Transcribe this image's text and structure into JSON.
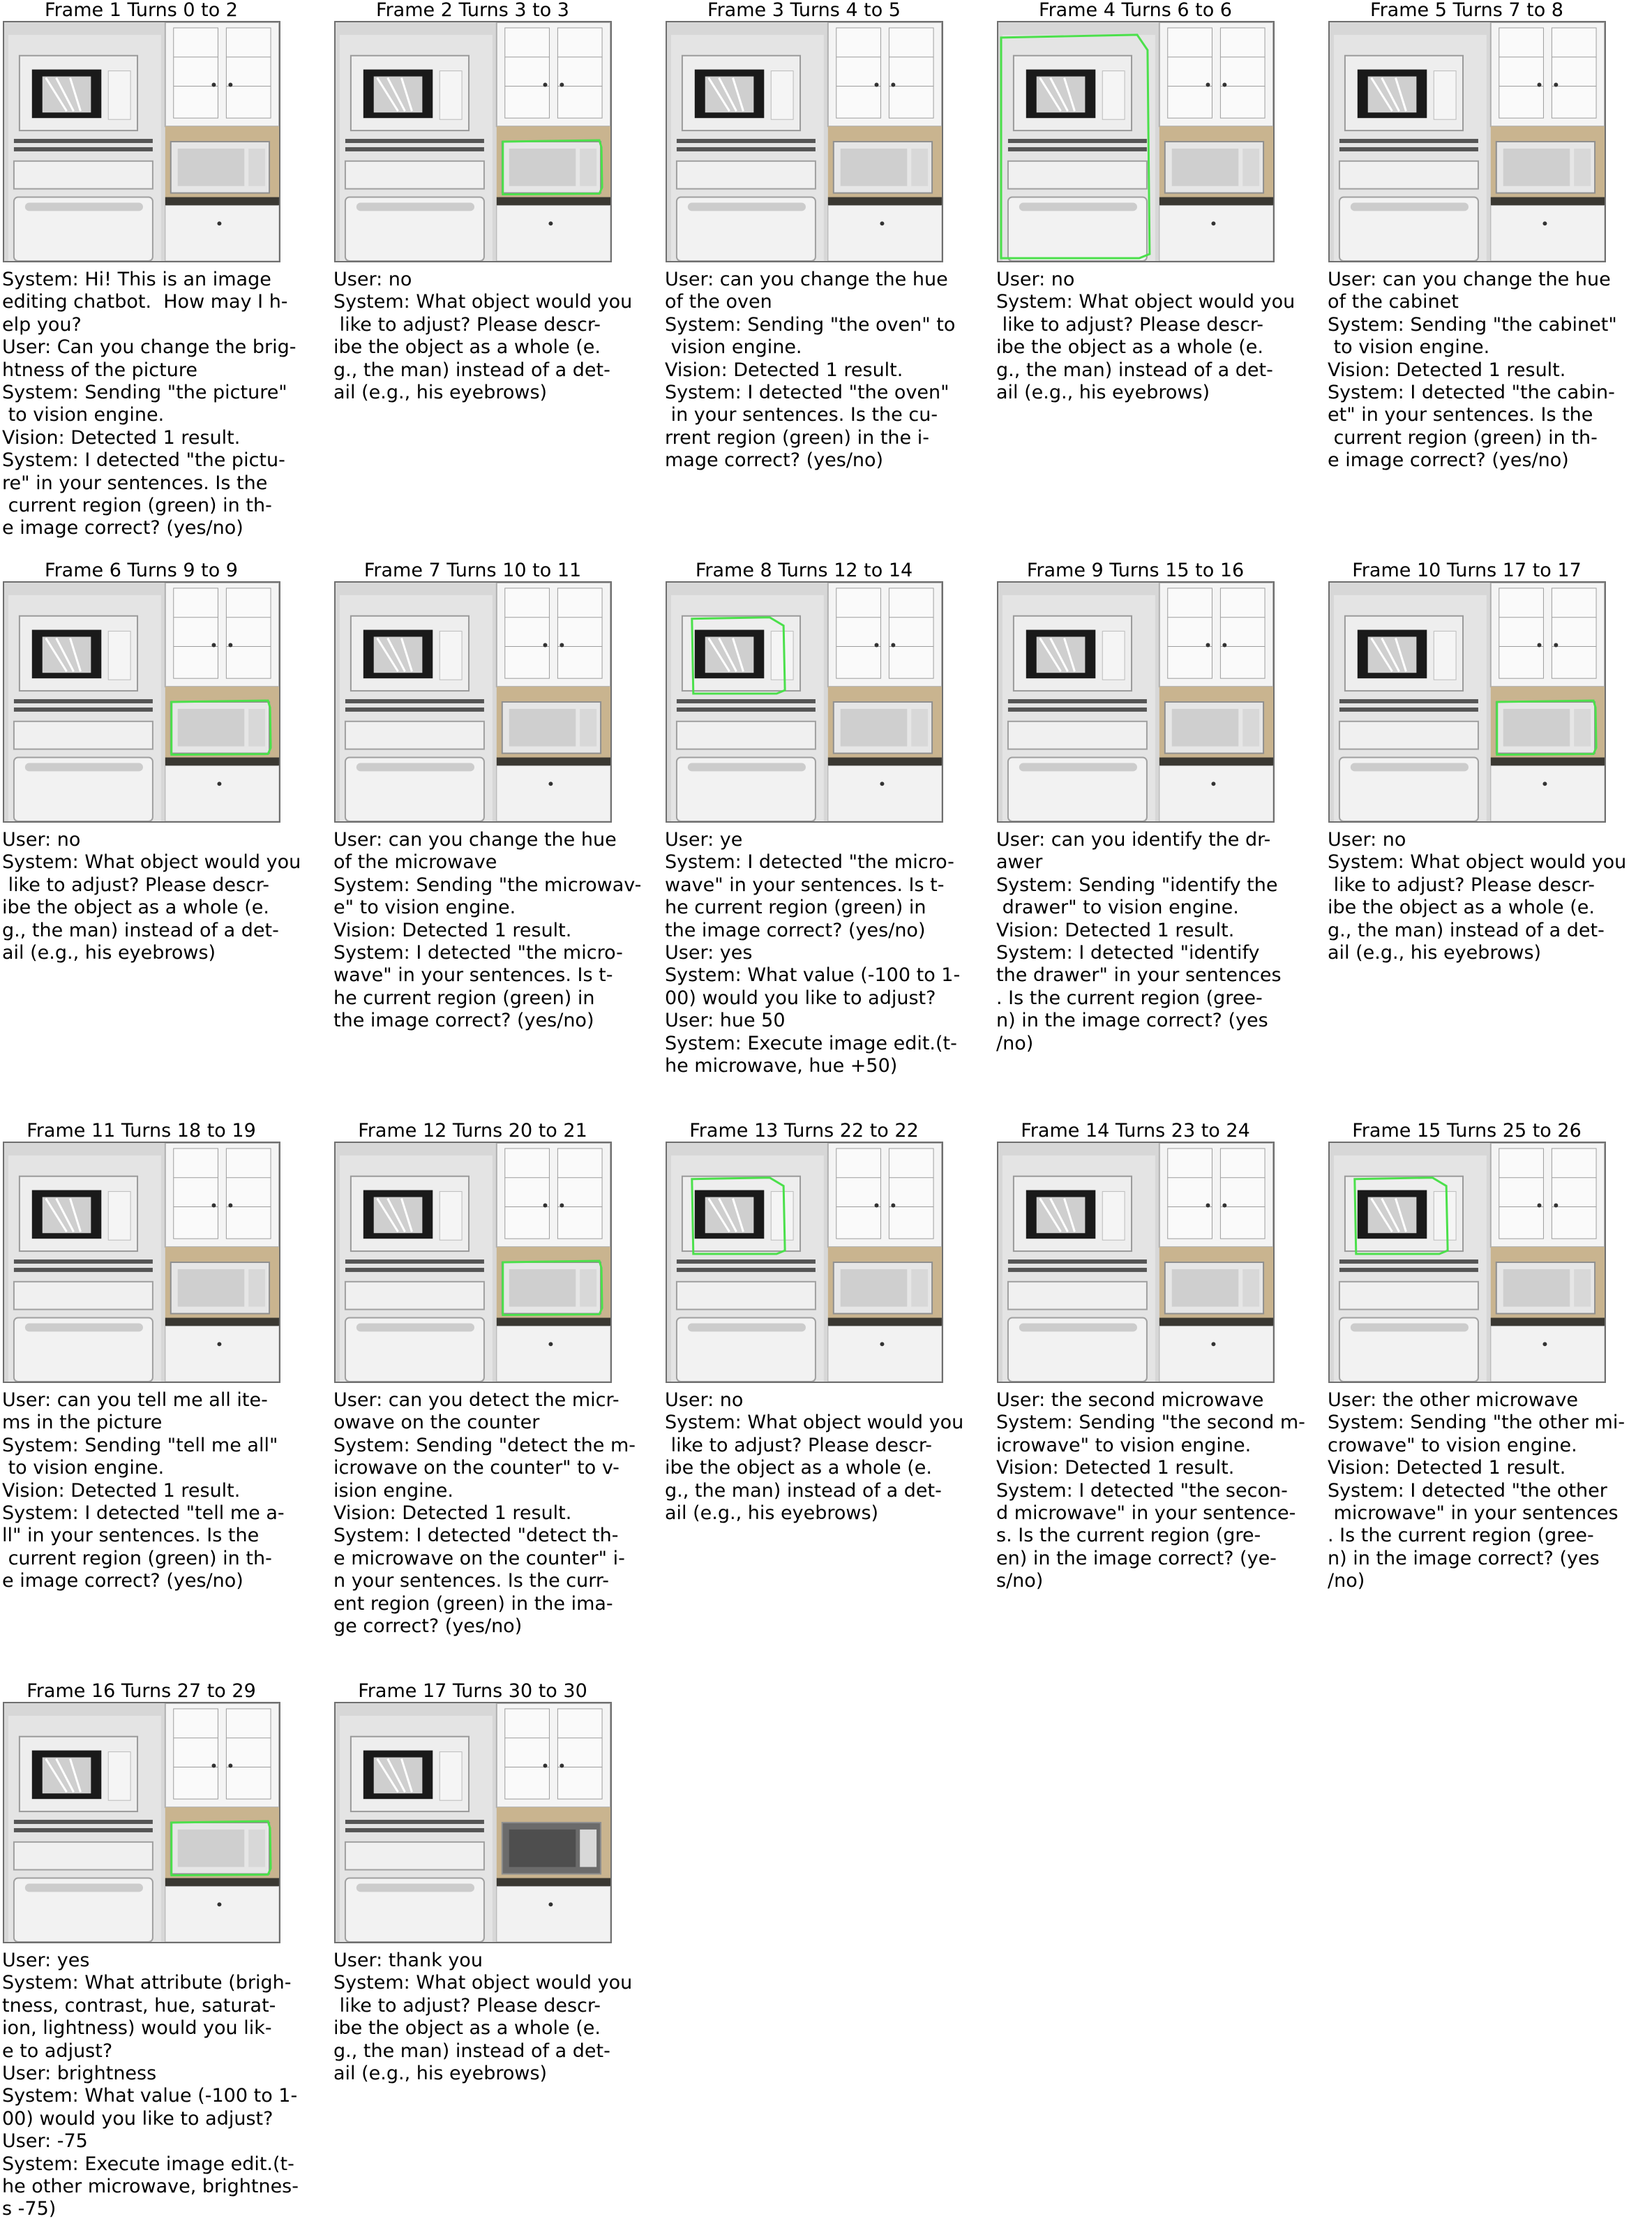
{
  "frames": [
    {
      "title": "Frame 1 Turns 0 to 2",
      "highlight": "",
      "edited": false,
      "text": "System: Hi! This is an image\nediting chatbot.  How may I h-\nelp you?\nUser: Can you change the brig-\nhtness of the picture\nSystem: Sending \"the picture\"\n to vision engine.\nVision: Detected 1 result.\nSystem: I detected \"the pictu-\nre\" in your sentences. Is the\n current region (green) in th-\ne image correct? (yes/no)"
    },
    {
      "title": "Frame 2 Turns 3 to 3",
      "highlight": "counter-microwave",
      "edited": false,
      "text": "User: no\nSystem: What object would you\n like to adjust? Please descr-\nibe the object as a whole (e.\ng., the man) instead of a det-\nail (e.g., his eyebrows)"
    },
    {
      "title": "Frame 3 Turns 4 to 5",
      "highlight": "",
      "edited": false,
      "text": "User: can you change the hue\nof the oven\nSystem: Sending \"the oven\" to\n vision engine.\nVision: Detected 1 result.\nSystem: I detected \"the oven\"\n in your sentences. Is the cu-\nrrent region (green) in the i-\nmage correct? (yes/no)"
    },
    {
      "title": "Frame 4 Turns 6 to 6",
      "highlight": "oven",
      "edited": false,
      "text": "User: no\nSystem: What object would you\n like to adjust? Please descr-\nibe the object as a whole (e.\ng., the man) instead of a det-\nail (e.g., his eyebrows)"
    },
    {
      "title": "Frame 5 Turns 7 to 8",
      "highlight": "",
      "edited": false,
      "text": "User: can you change the hue\nof the cabinet\nSystem: Sending \"the cabinet\"\n to vision engine.\nVision: Detected 1 result.\nSystem: I detected \"the cabin-\net\" in your sentences. Is the\n current region (green) in th-\ne image correct? (yes/no)"
    },
    {
      "title": "Frame 6 Turns 9 to 9",
      "highlight": "counter-microwave",
      "edited": false,
      "text": "User: no\nSystem: What object would you\n like to adjust? Please descr-\nibe the object as a whole (e.\ng., the man) instead of a det-\nail (e.g., his eyebrows)"
    },
    {
      "title": "Frame 7 Turns 10 to 11",
      "highlight": "",
      "edited": false,
      "text": "User: can you change the hue\nof the microwave\nSystem: Sending \"the microwav-\ne\" to vision engine.\nVision: Detected 1 result.\nSystem: I detected \"the micro-\nwave\" in your sentences. Is t-\nhe current region (green) in\nthe image correct? (yes/no)"
    },
    {
      "title": "Frame 8 Turns 12 to 14",
      "highlight": "wall-microwave",
      "edited": false,
      "text": "User: ye\nSystem: I detected \"the micro-\nwave\" in your sentences. Is t-\nhe current region (green) in\nthe image correct? (yes/no)\nUser: yes\nSystem: What value (-100 to 1-\n00) would you like to adjust?\nUser: hue 50\nSystem: Execute image edit.(t-\nhe microwave, hue +50)"
    },
    {
      "title": "Frame 9 Turns 15 to 16",
      "highlight": "",
      "edited": false,
      "text": "User: can you identify the dr-\nawer\nSystem: Sending \"identify the\n drawer\" to vision engine.\nVision: Detected 1 result.\nSystem: I detected \"identify\nthe drawer\" in your sentences\n. Is the current region (gree-\nn) in the image correct? (yes\n/no)"
    },
    {
      "title": "Frame 10 Turns 17 to 17",
      "highlight": "counter-microwave",
      "edited": false,
      "text": "User: no\nSystem: What object would you\n like to adjust? Please descr-\nibe the object as a whole (e.\ng., the man) instead of a det-\nail (e.g., his eyebrows)"
    },
    {
      "title": "Frame 11 Turns 18 to 19",
      "highlight": "",
      "edited": false,
      "text": "User: can you tell me all ite-\nms in the picture\nSystem: Sending \"tell me all\"\n to vision engine.\nVision: Detected 1 result.\nSystem: I detected \"tell me a-\nll\" in your sentences. Is the\n current region (green) in th-\ne image correct? (yes/no)"
    },
    {
      "title": "Frame 12 Turns 20 to 21",
      "highlight": "counter-microwave",
      "edited": false,
      "text": "User: can you detect the micr-\nowave on the counter\nSystem: Sending \"detect the m-\nicrowave on the counter\" to v-\nision engine.\nVision: Detected 1 result.\nSystem: I detected \"detect th-\ne microwave on the counter\" i-\nn your sentences. Is the curr-\nent region (green) in the ima-\nge correct? (yes/no)"
    },
    {
      "title": "Frame 13 Turns 22 to 22",
      "highlight": "wall-microwave",
      "edited": false,
      "text": "User: no\nSystem: What object would you\n like to adjust? Please descr-\nibe the object as a whole (e.\ng., the man) instead of a det-\nail (e.g., his eyebrows)"
    },
    {
      "title": "Frame 14 Turns 23 to 24",
      "highlight": "",
      "edited": false,
      "text": "User: the second microwave\nSystem: Sending \"the second m-\nicrowave\" to vision engine.\nVision: Detected 1 result.\nSystem: I detected \"the secon-\nd microwave\" in your sentence-\ns. Is the current region (gre-\nen) in the image correct? (ye-\ns/no)"
    },
    {
      "title": "Frame 15 Turns 25 to 26",
      "highlight": "wall-microwave",
      "edited": false,
      "text": "User: the other microwave\nSystem: Sending \"the other mi-\ncrowave\" to vision engine.\nVision: Detected 1 result.\nSystem: I detected \"the other\n microwave\" in your sentences\n. Is the current region (gree-\nn) in the image correct? (yes\n/no)"
    },
    {
      "title": "Frame 16 Turns 27 to 29",
      "highlight": "counter-microwave",
      "edited": false,
      "text": "User: yes\nSystem: What attribute (brigh-\ntness, contrast, hue, saturat-\nion, lightness) would you lik-\ne to adjust?\nUser: brightness\nSystem: What value (-100 to 1-\n00) would you like to adjust?\nUser: -75\nSystem: Execute image edit.(t-\nhe other microwave, brightnes-\ns -75)"
    },
    {
      "title": "Frame 17 Turns 30 to 30",
      "highlight": "",
      "edited": true,
      "text": "User: thank you\nSystem: What object would you\n like to adjust? Please descr-\nibe the object as a whole (e.\ng., the man) instead of a det-\nail (e.g., his eyebrows)"
    }
  ],
  "colors": {
    "highlight": "#4be04b",
    "wall": "#d7d7d7",
    "appliance": "#eeeeee",
    "countertop": "#3a3832",
    "edited_microwave": "#6b6b6b"
  }
}
